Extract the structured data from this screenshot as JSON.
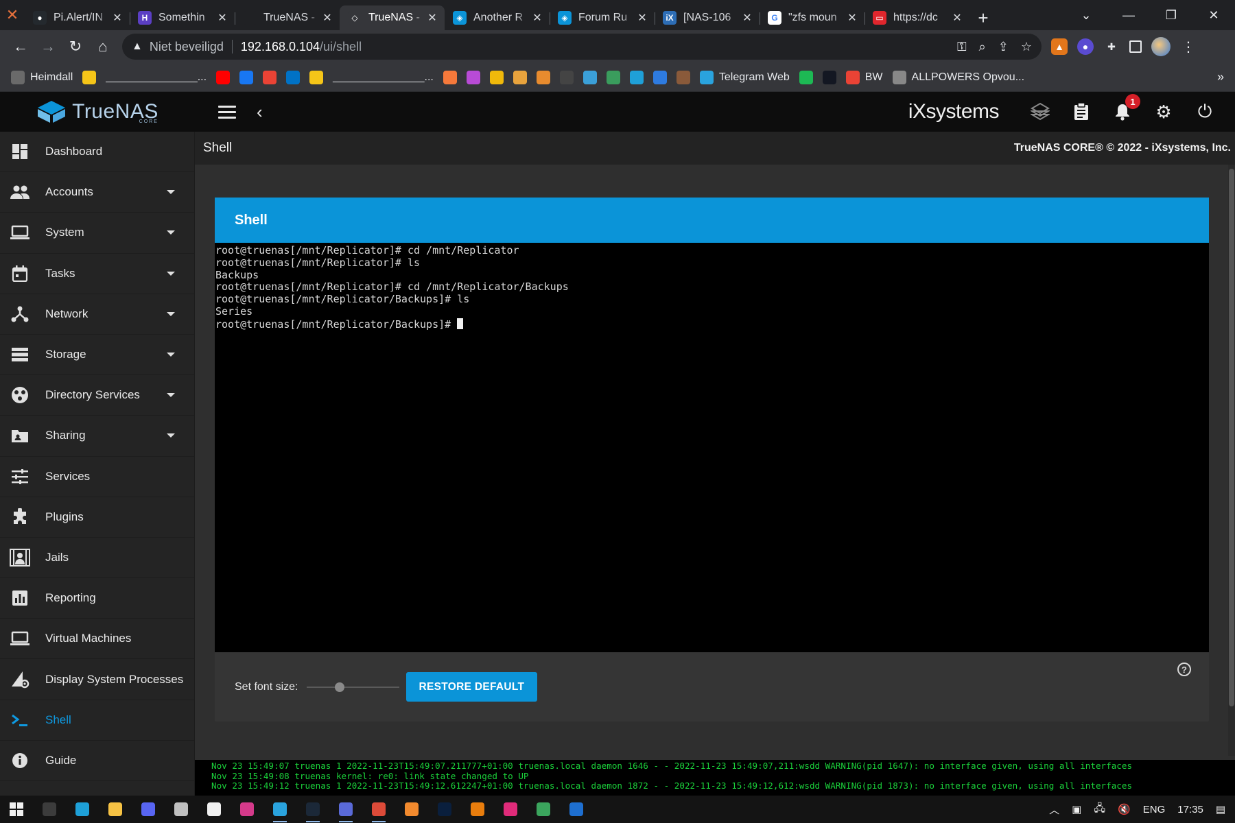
{
  "browser": {
    "tabs": [
      {
        "title": "Pi.Alert/IN",
        "icon_color": "#24292e",
        "icon_glyph": "●"
      },
      {
        "title": "Somethin",
        "icon_color": "#5b3fc4",
        "icon_glyph": "H"
      },
      {
        "title": "TrueNAS -",
        "icon_color": "#202124",
        "icon_glyph": ""
      },
      {
        "title": "TrueNAS -",
        "icon_color": "#35363a",
        "icon_glyph": "◇",
        "active": true
      },
      {
        "title": "Another R",
        "icon_color": "#0b94d8",
        "icon_glyph": "◈"
      },
      {
        "title": "Forum Ru",
        "icon_color": "#0b94d8",
        "icon_glyph": "◈"
      },
      {
        "title": "[NAS-106",
        "icon_color": "#2d6db5",
        "icon_glyph": "iX"
      },
      {
        "title": "\"zfs moun",
        "icon_color": "#ffffff",
        "icon_glyph": "G"
      },
      {
        "title": "https://dc",
        "icon_color": "#e0262d",
        "icon_glyph": "▭"
      }
    ],
    "address": {
      "security_label": "Niet beveiligd",
      "host": "192.168.0.104",
      "path": "/ui/shell"
    },
    "bookmarks": [
      {
        "label": "Heimdall",
        "color": "#6a6a6a"
      },
      {
        "label": "",
        "color": "#f5c518"
      },
      {
        "label": "_______________...",
        "color": ""
      },
      {
        "label": "",
        "color": "#ff0000"
      },
      {
        "label": "",
        "color": "#1877f2"
      },
      {
        "label": "",
        "color": "#ea4335"
      },
      {
        "label": "",
        "color": "#0072c6"
      },
      {
        "label": "",
        "color": "#f5c518"
      },
      {
        "label": "_______________...",
        "color": ""
      },
      {
        "label": "",
        "color": "#f5793b"
      },
      {
        "label": "",
        "color": "#b84bd6"
      },
      {
        "label": "",
        "color": "#f0b90b"
      },
      {
        "label": "",
        "color": "#e8a33d"
      },
      {
        "label": "",
        "color": "#e88b2e"
      },
      {
        "label": "",
        "color": "#444444"
      },
      {
        "label": "",
        "color": "#3ba0d9"
      },
      {
        "label": "",
        "color": "#3a9d5d"
      },
      {
        "label": "",
        "color": "#1fa0d8"
      },
      {
        "label": "",
        "color": "#2e7be0"
      },
      {
        "label": "",
        "color": "#8a5a3a"
      },
      {
        "label": "Telegram Web",
        "color": "#2aa3de"
      },
      {
        "label": "",
        "color": "#1db954"
      },
      {
        "label": "",
        "color": "#131722"
      },
      {
        "label": "BW",
        "color": "#ea4335"
      },
      {
        "label": "ALLPOWERS Opvou...",
        "color": "#888888"
      }
    ]
  },
  "app": {
    "brand": {
      "name": "TrueNAS",
      "edition": "CORE"
    },
    "vendor_logo": "iXsystems",
    "notification_count": "1",
    "page_title": "Shell",
    "copyright": "TrueNAS CORE® © 2022 - iXsystems, Inc.",
    "nav": [
      {
        "label": "Dashboard",
        "icon": "dashboard-icon",
        "expandable": false
      },
      {
        "label": "Accounts",
        "icon": "people-icon",
        "expandable": true
      },
      {
        "label": "System",
        "icon": "laptop-icon",
        "expandable": true
      },
      {
        "label": "Tasks",
        "icon": "calendar-icon",
        "expandable": true
      },
      {
        "label": "Network",
        "icon": "network-icon",
        "expandable": true
      },
      {
        "label": "Storage",
        "icon": "storage-icon",
        "expandable": true
      },
      {
        "label": "Directory Services",
        "icon": "directory-icon",
        "expandable": true
      },
      {
        "label": "Sharing",
        "icon": "folder-share-icon",
        "expandable": true
      },
      {
        "label": "Services",
        "icon": "tune-icon",
        "expandable": false
      },
      {
        "label": "Plugins",
        "icon": "puzzle-icon",
        "expandable": false
      },
      {
        "label": "Jails",
        "icon": "jail-icon",
        "expandable": false
      },
      {
        "label": "Reporting",
        "icon": "chart-icon",
        "expandable": false
      },
      {
        "label": "Virtual Machines",
        "icon": "monitor-icon",
        "expandable": false
      },
      {
        "label": "Display System Processes",
        "icon": "processes-icon",
        "expandable": false
      },
      {
        "label": "Shell",
        "icon": "shell-icon",
        "expandable": false,
        "active": true
      },
      {
        "label": "Guide",
        "icon": "info-icon",
        "expandable": false
      }
    ],
    "shell": {
      "card_title": "Shell",
      "lines": [
        "root@truenas[/mnt/Replicator]# cd /mnt/Replicator",
        "root@truenas[/mnt/Replicator]# ls",
        "Backups",
        "root@truenas[/mnt/Replicator]# cd /mnt/Replicator/Backups",
        "root@truenas[/mnt/Replicator/Backups]# ls",
        "Series"
      ],
      "prompt": "root@truenas[/mnt/Replicator/Backups]# ",
      "font_size_label": "Set font size:",
      "font_size_level": 0.36,
      "restore_label": "RESTORE DEFAULT",
      "help_glyph": "?"
    },
    "console_messages": [
      "Nov 23 15:49:07 truenas 1 2022-11-23T15:49:07.211777+01:00 truenas.local daemon 1646 - - 2022-11-23 15:49:07,211:wsdd WARNING(pid 1647): no interface given, using all interfaces",
      "Nov 23 15:49:08 truenas kernel: re0: link state changed to UP",
      "Nov 23 15:49:12 truenas 1 2022-11-23T15:49:12.612247+01:00 truenas.local daemon 1872 - - 2022-11-23 15:49:12,612:wsdd WARNING(pid 1873): no interface given, using all interfaces"
    ]
  },
  "taskbar": {
    "apps": [
      {
        "name": "task-view",
        "color": "#3c3c3c",
        "running": false
      },
      {
        "name": "ccleaner",
        "color": "#1ea0d8",
        "running": false
      },
      {
        "name": "explorer",
        "color": "#f6c244",
        "running": false
      },
      {
        "name": "discord",
        "color": "#5865f2",
        "running": false
      },
      {
        "name": "app-5",
        "color": "#c0c0c0",
        "running": false
      },
      {
        "name": "notepad",
        "color": "#f0f0f0",
        "running": false
      },
      {
        "name": "app-7",
        "color": "#d43a8a",
        "running": false
      },
      {
        "name": "telegram",
        "color": "#2aa3de",
        "running": true
      },
      {
        "name": "steam",
        "color": "#1b2838",
        "running": true
      },
      {
        "name": "app-10",
        "color": "#5a6ad8",
        "running": true
      },
      {
        "name": "chrome",
        "color": "#dd4b39",
        "running": true
      },
      {
        "name": "sublime",
        "color": "#f28a2e",
        "running": false
      },
      {
        "name": "photoshop",
        "color": "#0a1f3d",
        "running": false
      },
      {
        "name": "blender",
        "color": "#e87d0d",
        "running": false
      },
      {
        "name": "app-15",
        "color": "#e02b7a",
        "running": false
      },
      {
        "name": "app-16",
        "color": "#3ba55d",
        "running": false
      },
      {
        "name": "app-17",
        "color": "#1e6fd0",
        "running": false
      }
    ],
    "language": "ENG",
    "clock": "17:35"
  }
}
